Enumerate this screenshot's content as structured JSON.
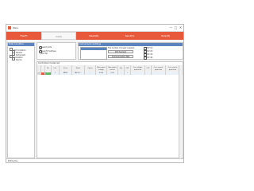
{
  "app": {
    "title": "PGLL"
  },
  "window_controls": {
    "minimize": "—",
    "maximize": "□",
    "close": "✕"
  },
  "tabs": [
    {
      "label": "File(F)",
      "active": false
    },
    {
      "label": "Init(I)",
      "active": true
    },
    {
      "label": "Read(R)",
      "active": false
    },
    {
      "label": "Send(S)",
      "active": false
    },
    {
      "label": "Help(H)",
      "active": false
    }
  ],
  "left_panel": {
    "title": "Total Condition",
    "tree": [
      {
        "label": "Port Condition"
      },
      {
        "label": "Monitor"
      },
      {
        "label": "Instrument"
      },
      {
        "label": "Simulation"
      },
      {
        "label": "Device"
      }
    ]
  },
  "config": {
    "radio1": "Select ports",
    "radio2": "Specif IP address",
    "field_label": "Port No."
  },
  "instruments": {
    "title": "Instruments Settings",
    "label_num": "The number of power supplies",
    "btn_scan": "Port Scanner",
    "btn_test": "Communication Test",
    "checks": [
      "OVP 1D",
      "OVP 2D",
      "OVP 3D",
      "OVP 4D"
    ]
  },
  "table": {
    "title": "Controlled model list",
    "columns": [
      "",
      "",
      "No.",
      "Unit",
      "Series",
      "Model",
      "Option",
      "Max output voltage",
      "Max output current",
      "Slot",
      "OVP",
      "Over voltage protection",
      "OCP",
      "Over current protection",
      "Over current protection"
    ],
    "row": [
      "✓",
      "1",
      "1",
      "1",
      "PAV35",
      "PAV 35-...",
      "-",
      "0.000",
      "0.00",
      "-",
      "✓",
      "",
      "",
      "",
      ""
    ]
  },
  "status": {
    "text": "Editing the..."
  },
  "colors": {
    "accent": "#e8583a",
    "header_blue": "#5b84bf"
  }
}
